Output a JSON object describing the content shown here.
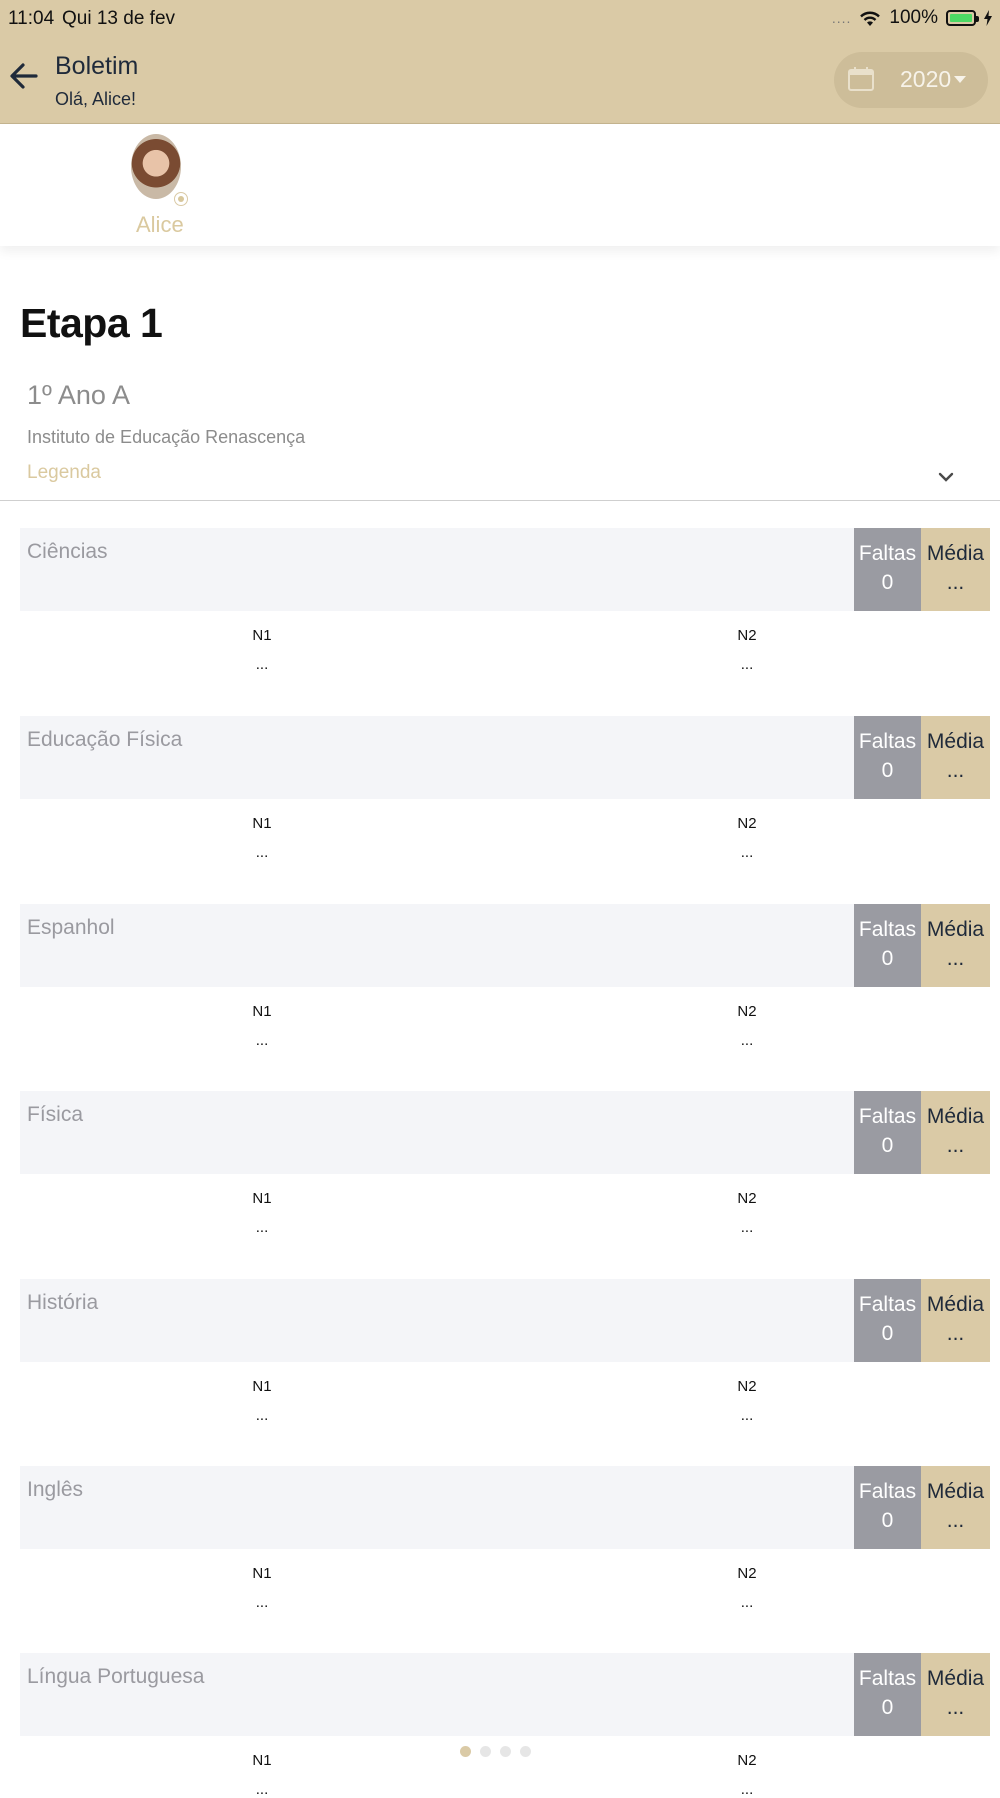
{
  "status_bar": {
    "time": "11:04",
    "date": "Qui 13 de fev",
    "signal_dots": "....",
    "battery_percent": "100%",
    "battery_level": 1.0
  },
  "header": {
    "title": "Boletim",
    "subtitle": "Olá, Alice!",
    "year": "2020",
    "icons": [
      "back-arrow-icon",
      "calendar-icon",
      "caret-down-icon"
    ]
  },
  "profile": {
    "name": "Alice"
  },
  "stage": {
    "title": "Etapa 1",
    "class_name": "1º Ano A",
    "school": "Instituto de Educação Renascença",
    "legend_label": "Legenda"
  },
  "labels": {
    "faltas": "Faltas",
    "media": "Média",
    "n1": "N1",
    "n2": "N2"
  },
  "subjects": [
    {
      "name": "Ciências",
      "faltas": "0",
      "media": "...",
      "n1": "...",
      "n2": "..."
    },
    {
      "name": "Educação Física",
      "faltas": "0",
      "media": "...",
      "n1": "...",
      "n2": "..."
    },
    {
      "name": "Espanhol",
      "faltas": "0",
      "media": "...",
      "n1": "...",
      "n2": "..."
    },
    {
      "name": "Física",
      "faltas": "0",
      "media": "...",
      "n1": "...",
      "n2": "..."
    },
    {
      "name": "História",
      "faltas": "0",
      "media": "...",
      "n1": "...",
      "n2": "..."
    },
    {
      "name": "Inglês",
      "faltas": "0",
      "media": "...",
      "n1": "...",
      "n2": "..."
    },
    {
      "name": "Língua Portuguesa",
      "faltas": "0",
      "media": "...",
      "n1": "...",
      "n2": "..."
    }
  ],
  "pagination": {
    "total_pages": 4,
    "active_page": 1
  },
  "colors": {
    "brand": "#dacaa6",
    "faltas_bg": "#9a9ba2",
    "subject_bg": "#f4f5f8"
  }
}
